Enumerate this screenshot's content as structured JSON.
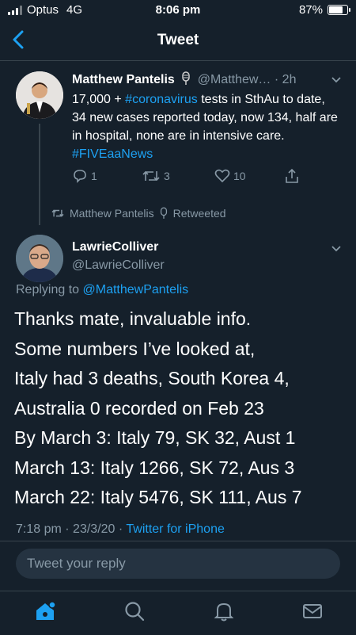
{
  "status_bar": {
    "carrier": "Optus",
    "network": "4G",
    "time": "8:06 pm",
    "battery": "87%",
    "battery_level": 0.87
  },
  "nav": {
    "title": "Tweet",
    "back_icon": "chevron-left-icon"
  },
  "retweet": {
    "author_name": "Matthew Pantelis",
    "handle": "@Matthew…",
    "time_ago": "· 2h",
    "body_parts": [
      {
        "text": "17,000 + ",
        "type": "text"
      },
      {
        "text": "#coronavirus",
        "type": "hashtag"
      },
      {
        "text": " tests in SthAu to date, 34 new cases reported today, now 134, half are in hospital, none are in intensive care. ",
        "type": "text"
      },
      {
        "text": "#FIVEaaNews",
        "type": "hashtag"
      }
    ],
    "reply_count": "1",
    "retweet_count": "3",
    "like_count": "10"
  },
  "retweeted_by": {
    "name": "Matthew Pantelis",
    "label": "Retweeted"
  },
  "tweet": {
    "author_name": "LawrieColliver",
    "handle": "@LawrieColliver",
    "replying_prefix": "Replying to",
    "replying_handle": "@MatthewPantelis",
    "lines": [
      "Thanks mate, invaluable info.",
      "Some numbers I’ve looked at,",
      "Italy had 3 deaths, South Korea 4,",
      "Australia 0 recorded on Feb 23",
      "By March 3: Italy 79, SK 32, Aust 1",
      "March 13: Italy 1266, SK 72, Aus 3",
      "March 22: Italy 5476, SK 111, Aus 7"
    ],
    "time": "7:18 pm",
    "date": "23/3/20",
    "source": "Twitter for iPhone"
  },
  "reply": {
    "placeholder": "Tweet your reply"
  },
  "tabs": [
    {
      "name": "home-icon",
      "active": true
    },
    {
      "name": "search-icon",
      "active": false
    },
    {
      "name": "bell-icon",
      "active": false
    },
    {
      "name": "mail-icon",
      "active": false
    }
  ],
  "colors": {
    "background": "#15202b",
    "accent": "#1da1f2",
    "muted": "#8899a6",
    "divider": "#38444d",
    "reply_box": "#253341"
  }
}
